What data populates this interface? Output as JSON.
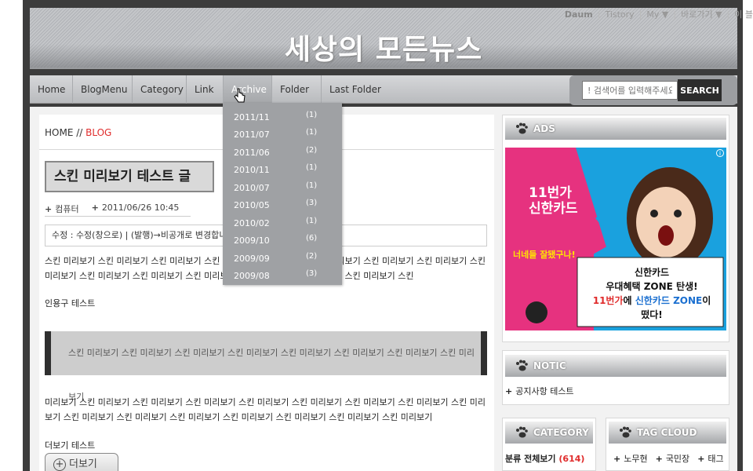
{
  "site": {
    "title": "세상의 모든뉴스"
  },
  "topbar": {
    "brand": "Daum",
    "items": [
      "Tistory",
      "My ▼",
      "바로가기 ▼",
      "이 블"
    ]
  },
  "nav": {
    "items": [
      "Home",
      "BlogMenu",
      "Category",
      "Link",
      "Archive",
      "Folder 1",
      "Last Folder"
    ]
  },
  "search": {
    "placeholder": "! 검색어를 입력해주세요",
    "button": "SEARCH"
  },
  "breadcrumb": {
    "home": "HOME",
    "sep": " // ",
    "current": "BLOG"
  },
  "post": {
    "title": "스킨 미리보기 테스트 글",
    "category": "컴퓨터",
    "datetime": "2011/06/26 10:45",
    "edit_line": "수정 : 수정(창으로) | (발행)→비공개로 변경합니다",
    "body1": "스킨 미리보기 스킨 미리보기 스킨 미리보기 스킨 미리보기 스킨 미리보기 스킨 미리보기 스킨 미리보기 스킨 미리보기 스킨 미리보기 스킨 미리보기 스킨 미리보기 스킨 미리보기 스킨 미리보기 스킨 미리보기 스킨 미리보기 스킨",
    "quote_label": "인용구 테스트",
    "quote": "스킨 미리보기 스킨 미리보기 스킨 미리보기 스킨 미리보기 스킨 미리보기 스킨 미리보기 스킨 미리보기 스킨 미리보기",
    "body2": "미리보기 스킨 미리보기 스킨 미리보기 스킨 미리보기 스킨 미리보기 스킨 미리보기 스킨 미리보기 스킨 미리보기 스킨 미리보기 스킨 미리보기 스킨 미리보기 스킨 미리보기 스킨 미리보기 스킨 미리보기 스킨 미리보기 스킨 미리보기",
    "more_label": "더보기 테스트",
    "more_button": "더보기"
  },
  "archive": [
    {
      "month": "2011/11",
      "count": "(1)"
    },
    {
      "month": "2011/07",
      "count": "(1)"
    },
    {
      "month": "2011/06",
      "count": "(2)"
    },
    {
      "month": "2010/11",
      "count": "(1)"
    },
    {
      "month": "2010/07",
      "count": "(1)"
    },
    {
      "month": "2010/05",
      "count": "(3)"
    },
    {
      "month": "2010/02",
      "count": "(1)"
    },
    {
      "month": "2009/10",
      "count": "(6)"
    },
    {
      "month": "2009/09",
      "count": "(2)"
    },
    {
      "month": "2009/08",
      "count": "(3)"
    }
  ],
  "sidebar": {
    "ads_title": "ADS",
    "ad": {
      "line1": "11번가",
      "line2": "신한카드",
      "line3": "너네들 잘됐구나!",
      "box1": "신한카드",
      "box2": "우대혜택 ZONE 탄생!",
      "box3a": "11번가",
      "box3b": "에 ",
      "box3c": "신한카드 ZONE",
      "box3d": "이",
      "box4": "떴다!"
    },
    "notice_title": "NOTIC",
    "notice_item": "공지사항 테스트",
    "category_title": "CATEGORY",
    "category_all": "분류 전체보기",
    "category_count": "(614)",
    "tag_title": "TAG CLOUD",
    "tags": [
      "노무현",
      "국민장",
      "태그"
    ]
  }
}
